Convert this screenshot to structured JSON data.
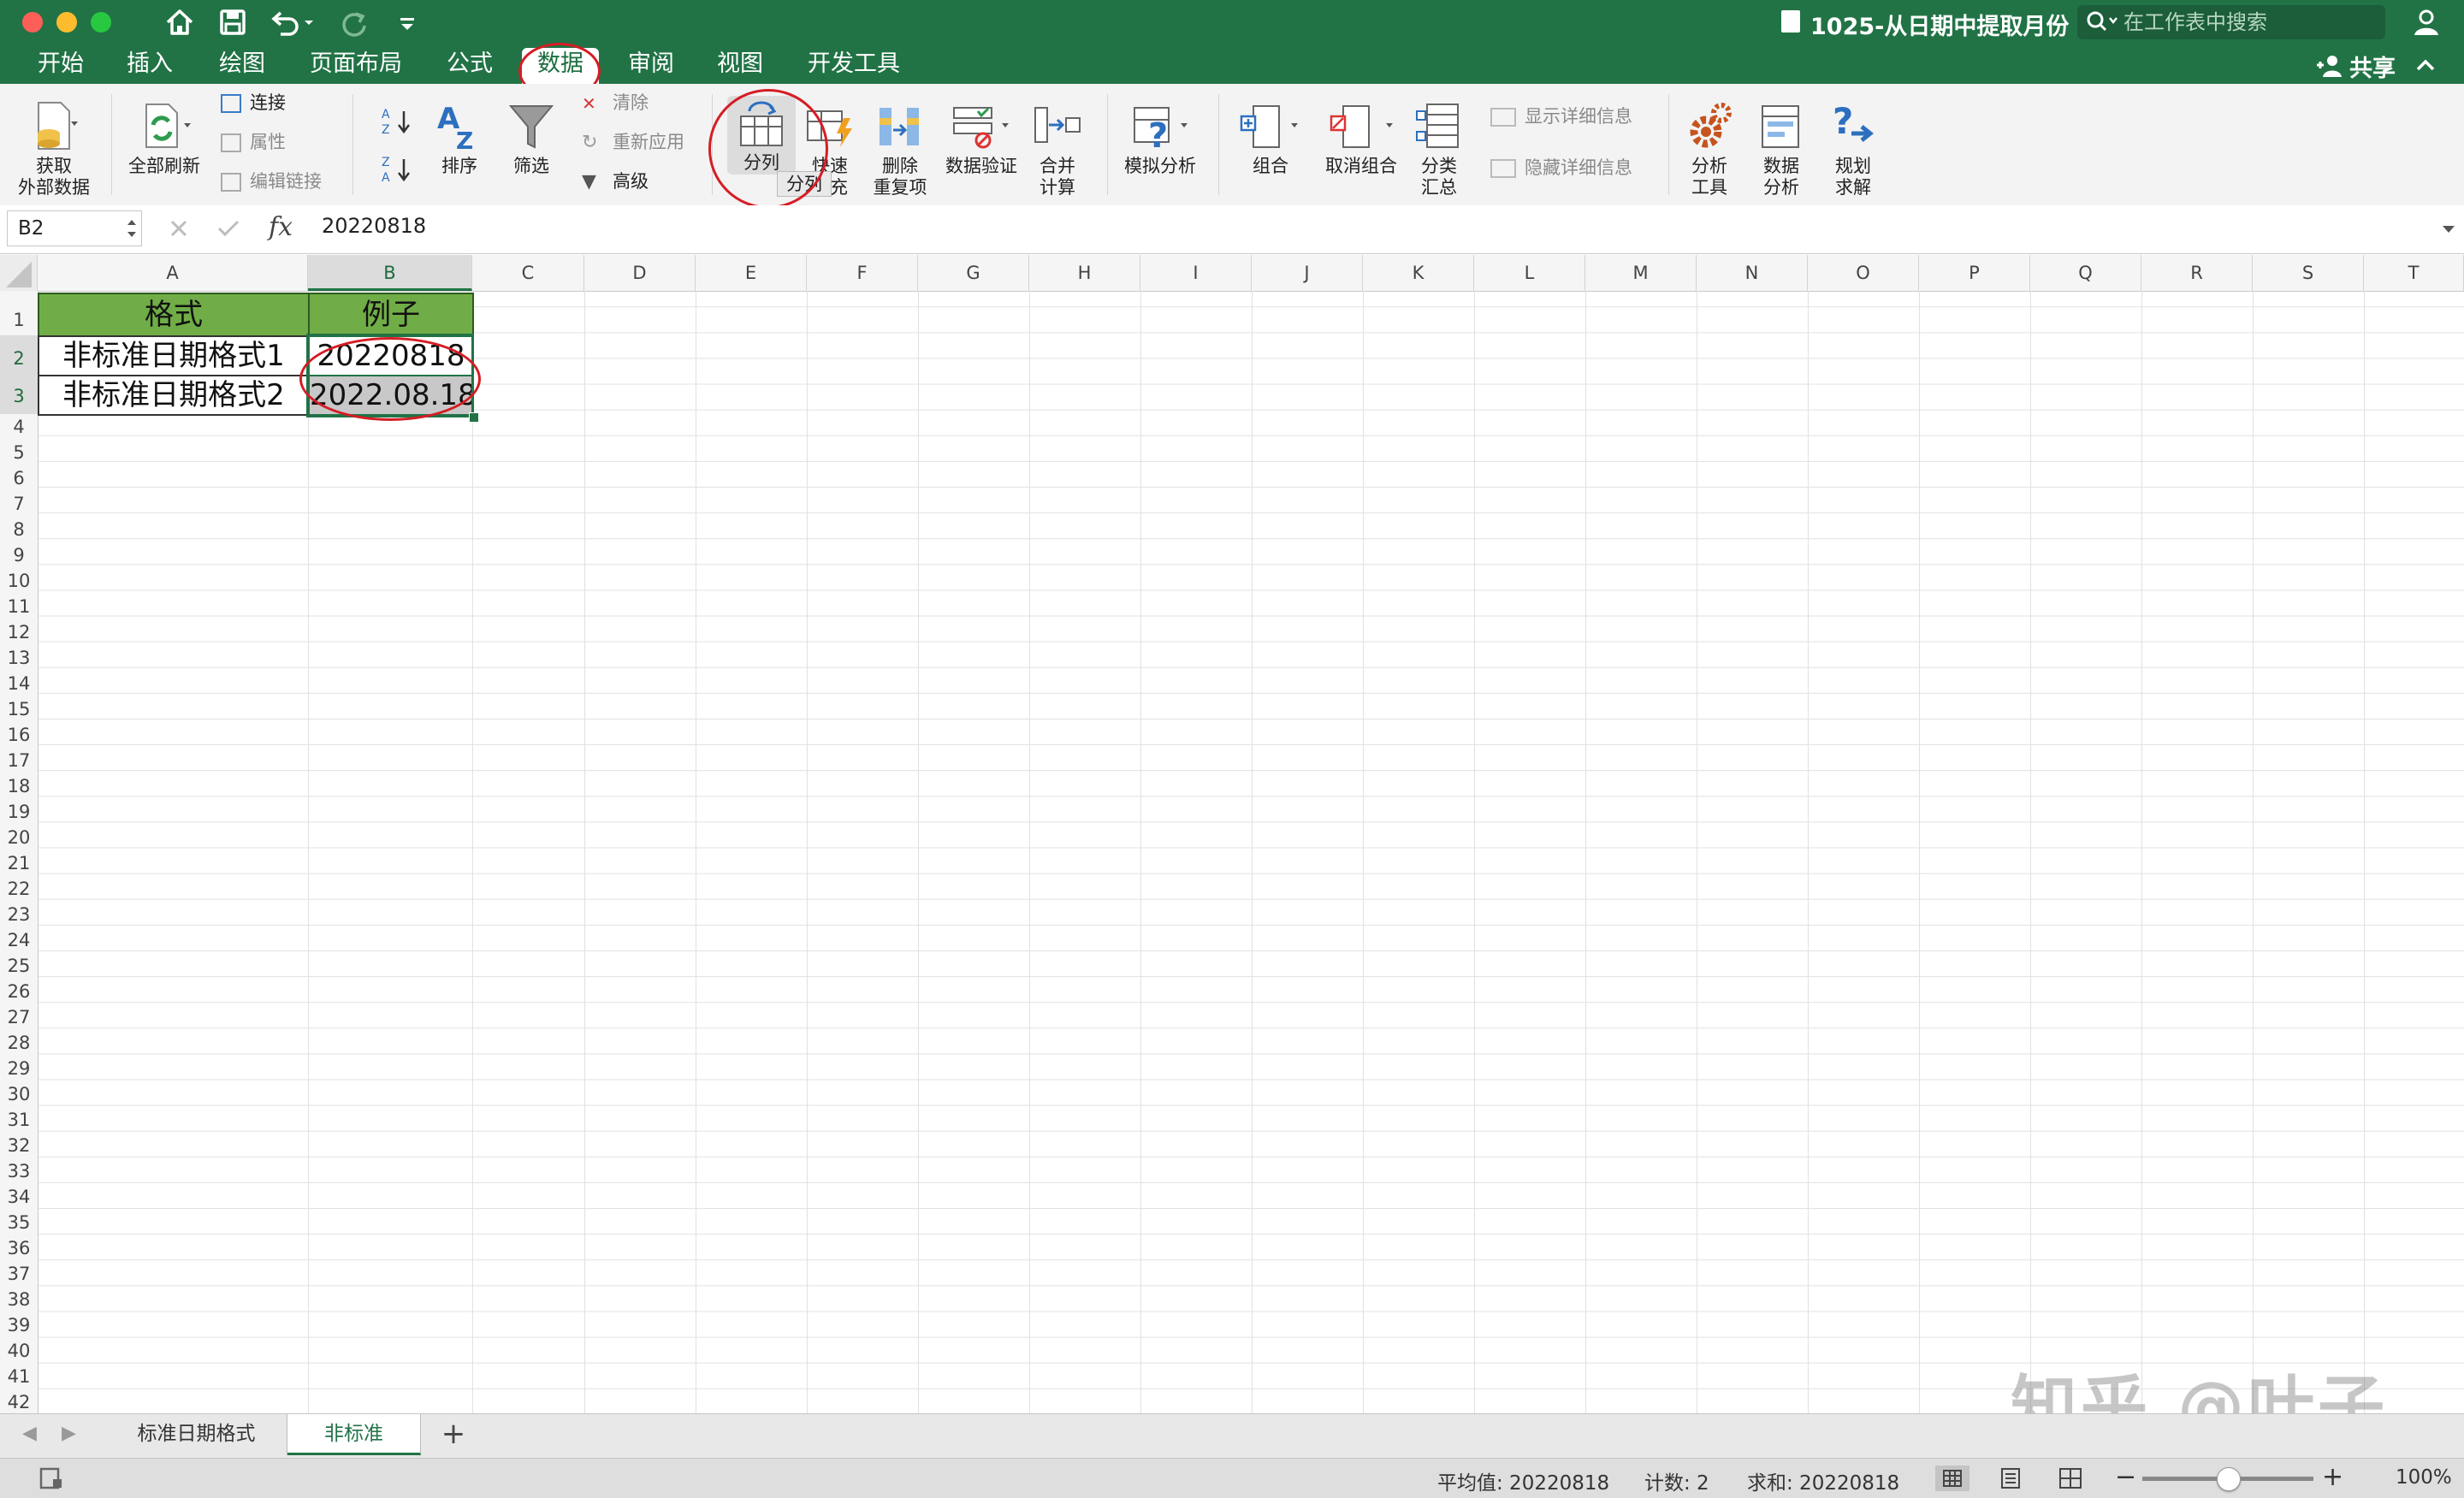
{
  "window": {
    "title": "1025-从日期中提取月份",
    "search_placeholder": "在工作表中搜索",
    "share_label": "共享"
  },
  "tabs": [
    {
      "label": "开始"
    },
    {
      "label": "插入"
    },
    {
      "label": "绘图"
    },
    {
      "label": "页面布局"
    },
    {
      "label": "公式"
    },
    {
      "label": "数据"
    },
    {
      "label": "审阅"
    },
    {
      "label": "视图"
    },
    {
      "label": "开发工具"
    }
  ],
  "active_tab": "数据",
  "ribbon": {
    "get_external_line1": "获取",
    "get_external_line2": "外部数据",
    "refresh_all": "全部刷新",
    "connections": "连接",
    "properties": "属性",
    "edit_links": "编辑链接",
    "sort": "排序",
    "filter": "筛选",
    "clear": "清除",
    "reapply": "重新应用",
    "advanced": "高级",
    "text_to_columns": "分列",
    "flash_fill_line1": "快速",
    "flash_fill_line2": "填充",
    "tooltip": "分列",
    "remove_dup_line1": "删除",
    "remove_dup_line2": "重复项",
    "data_validation": "数据验证",
    "consolidate_line1": "合并",
    "consolidate_line2": "计算",
    "what_if": "模拟分析",
    "group": "组合",
    "ungroup": "取消组合",
    "subtotal_line1": "分类",
    "subtotal_line2": "汇总",
    "show_detail": "显示详细信息",
    "hide_detail": "隐藏详细信息",
    "analysis_tools_line1": "分析",
    "analysis_tools_line2": "工具",
    "data_analysis_line1": "数据",
    "data_analysis_line2": "分析",
    "solver_line1": "规划",
    "solver_line2": "求解"
  },
  "formula_bar": {
    "cell_ref": "B2",
    "fx_label": "fx",
    "value": "20220818"
  },
  "columns": [
    "A",
    "B",
    "C",
    "D",
    "E",
    "F",
    "G",
    "H",
    "I",
    "J",
    "K",
    "L",
    "M",
    "N",
    "O",
    "P",
    "Q",
    "R",
    "S",
    "T"
  ],
  "rows": [
    "1",
    "2",
    "3",
    "4",
    "5",
    "6",
    "7",
    "8",
    "9",
    "10",
    "11",
    "12",
    "13",
    "14",
    "15",
    "16",
    "17",
    "18",
    "19",
    "20",
    "21",
    "22",
    "23",
    "24",
    "25",
    "26",
    "27",
    "28",
    "29",
    "30",
    "31",
    "32",
    "33",
    "34",
    "35",
    "36",
    "37",
    "38",
    "39",
    "40",
    "41",
    "42"
  ],
  "cells": {
    "A1": "格式",
    "B1": "例子",
    "A2": "非标准日期格式1",
    "B2": "20220818",
    "A3": "非标准日期格式2",
    "B3": "2022.08.18"
  },
  "sheets": [
    {
      "label": "标准日期格式"
    },
    {
      "label": "非标准"
    }
  ],
  "add_sheet_label": "+",
  "status": {
    "average": "平均值: 20220818",
    "count": "计数: 2",
    "sum": "求和: 20220818",
    "zoom": "100%",
    "zoom_level": 0.5
  },
  "watermark": "知乎 @叶子",
  "colors": {
    "brand": "#217346",
    "header_fill": "#70ad47",
    "annotation_red": "#d51d25"
  }
}
